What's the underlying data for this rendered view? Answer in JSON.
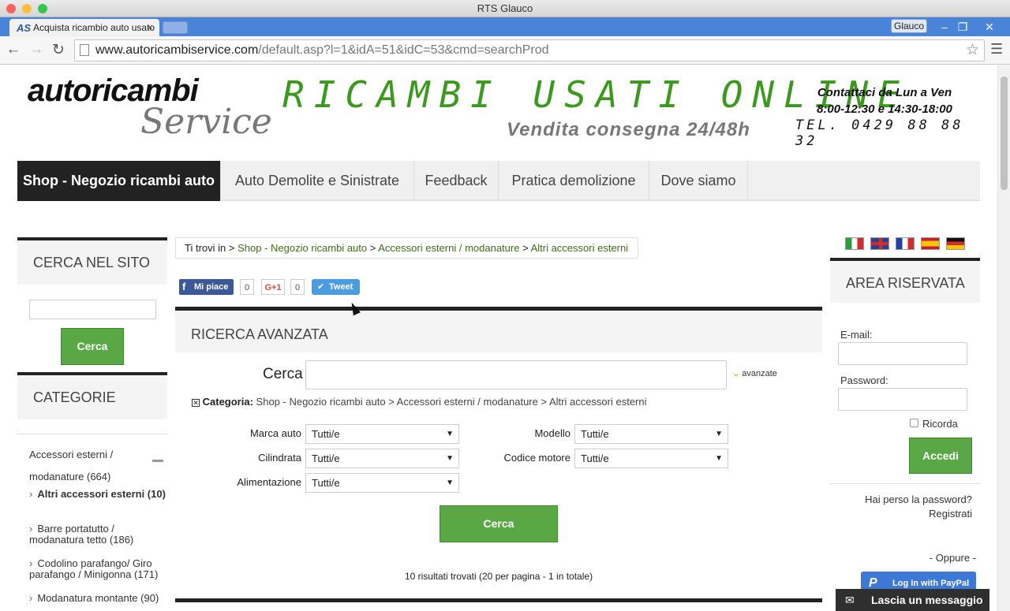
{
  "window": {
    "title": "RTS Glauco",
    "user": "Glauco"
  },
  "tab": {
    "title": "Acquista ricambio auto usato",
    "favicon": "AS",
    "close": "×"
  },
  "address": {
    "domain": "www.autoricambiservice.com",
    "path": "/default.asp?l=1&idA=51&idC=53&cmd=searchProd"
  },
  "header": {
    "logo_top": "autoricambi",
    "logo_bottom": "Service",
    "banner": "RICAMBI USATI ONLINE",
    "subtitle": "Vendita consegna 24/48h",
    "contact_line1": "Contattaci da Lun a Ven",
    "contact_line2": "8:00-12:30 e 14:30-18:00",
    "phone": "TEL. 0429 88 88 32"
  },
  "nav": [
    "Shop - Negozio ricambi auto",
    "Auto Demolite e Sinistrate",
    "Feedback",
    "Pratica demolizione",
    "Dove siamo"
  ],
  "left": {
    "search_title": "CERCA NEL SITO",
    "search_button": "Cerca",
    "categories_title": "CATEGORIE",
    "categories": [
      {
        "label": "Accessori esterni / modanature (664)"
      },
      {
        "label": "Altri accessori esterni (10)"
      },
      {
        "label": "Barre portatutto / modanatura tetto (186)"
      },
      {
        "label": "Codolino parafango/ Giro parafango / Minigonna (171)"
      },
      {
        "label": "Modanatura montante (90)"
      }
    ]
  },
  "breadcrumb": {
    "prefix": "Ti trovi in",
    "sep": ">",
    "items": [
      "Shop - Negozio ricambi auto",
      "Accessori esterni / modanature",
      "Altri accessori esterni"
    ]
  },
  "social": {
    "fb_label": "Mi piace",
    "fb_count": "0",
    "gplus_label": "G+1",
    "gplus_count": "0",
    "tweet_label": "Tweet"
  },
  "advanced": {
    "title": "RICERCA AVANZATA",
    "search_label": "Cerca",
    "toggle_label": "avanzate",
    "category_label": "Categoria:",
    "category_path": "Shop - Negozio ricambi auto > Accessori esterni / modanature > Altri accessori esterni",
    "fields": {
      "marca": "Marca auto",
      "modello": "Modello",
      "cilindrata": "Cilindrata",
      "codice": "Codice motore",
      "alimentazione": "Alimentazione"
    },
    "default_option": "Tutti/e",
    "button": "Cerca",
    "results": "10 risultati trovati (20 per pagina - 1 in totale)"
  },
  "right": {
    "title": "AREA RISERVATA",
    "email_label": "E-mail:",
    "password_label": "Password:",
    "remember_label": "Ricorda",
    "login_button": "Accedi",
    "lost_password": "Hai perso la password?",
    "register": "Registrati",
    "or": "- Oppure -",
    "paypal": "Log In with PayPal"
  },
  "chat": {
    "label": "Lascia un messaggio"
  },
  "colors": {
    "green": "#5aa845",
    "dark": "#222222",
    "link_green": "#3a6f16",
    "banner_green": "#3b9a1e"
  }
}
